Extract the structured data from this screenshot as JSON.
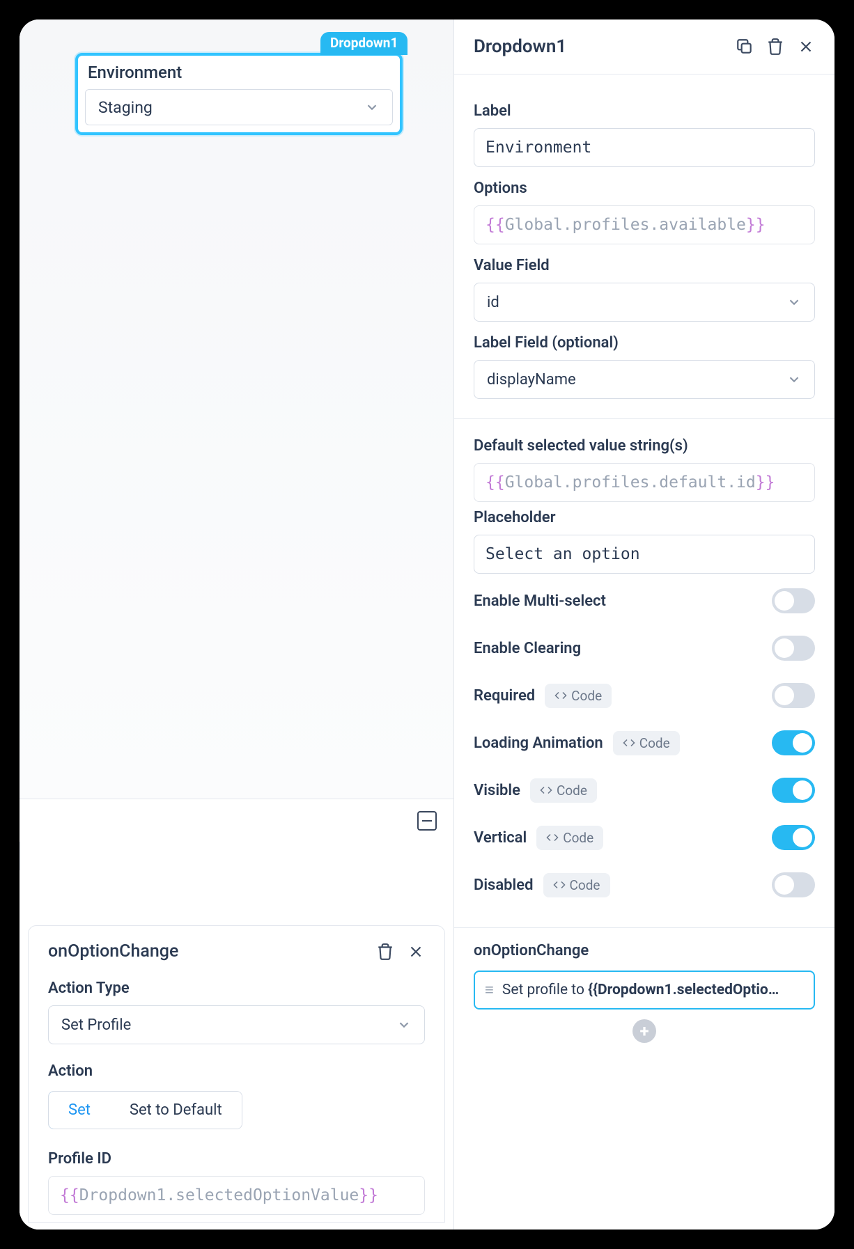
{
  "canvas": {
    "widget_tag": "Dropdown1",
    "widget_label": "Environment",
    "widget_value": "Staging"
  },
  "action_panel": {
    "title": "onOptionChange",
    "fields": {
      "action_type_label": "Action Type",
      "action_type_value": "Set Profile",
      "action_label": "Action",
      "segments": {
        "set": "Set",
        "set_default": "Set to Default"
      },
      "profile_id_label": "Profile ID",
      "profile_id_expr": {
        "open": "{{",
        "ident": "Dropdown1",
        "rest": ".selectedOptionValue",
        "close": "}}"
      }
    }
  },
  "inspector": {
    "title": "Dropdown1",
    "label_field": "Label",
    "label_value": "Environment",
    "options_field": "Options",
    "options_expr": {
      "open": "{{",
      "ident": "Global",
      "rest": ".profiles.available",
      "close": "}}"
    },
    "value_field_label": "Value Field",
    "value_field_value": "id",
    "label_field_label": "Label Field (optional)",
    "label_field_value": "displayName",
    "default_label": "Default selected value string(s)",
    "default_expr": {
      "open": "{{",
      "ident": "Global",
      "rest": ".profiles.default.id",
      "close": "}}"
    },
    "placeholder_label": "Placeholder",
    "placeholder_value": "Select an option",
    "toggles": {
      "multi": "Enable Multi-select",
      "clear": "Enable Clearing",
      "required": "Required",
      "loading": "Loading Animation",
      "visible": "Visible",
      "vertical": "Vertical",
      "disabled": "Disabled"
    },
    "code_chip": "Code",
    "event_label": "onOptionChange",
    "event_text_prefix": "Set profile to ",
    "event_text_bold": "{{Dropdown1.selectedOptio…"
  }
}
